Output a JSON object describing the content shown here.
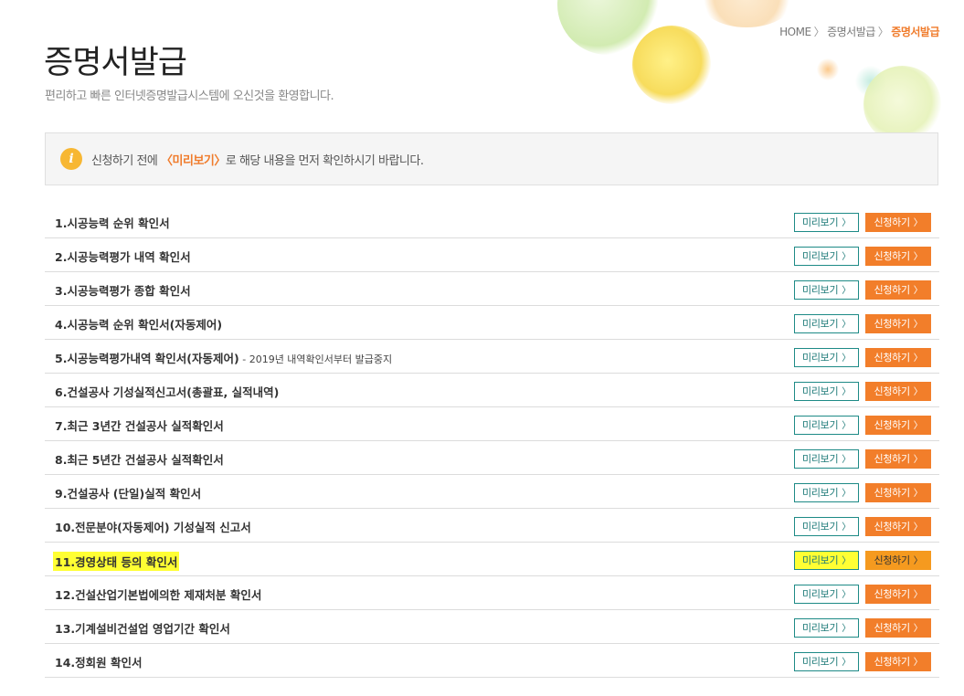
{
  "breadcrumb": {
    "home": "HOME",
    "parent": "증명서발급",
    "current": "증명서발급",
    "sep": "〉"
  },
  "page": {
    "title": "증명서발급",
    "subtitle": "편리하고 빠른 인터넷증명발급시스템에 오신것을 환영합니다."
  },
  "notice": {
    "icon": "i",
    "before": "신청하기 전에 ",
    "highlight": "〈미리보기〉",
    "after": "로 해당 내용을 먼저 확인하시기 바랍니다."
  },
  "buttons": {
    "preview_label": "미리보기",
    "apply_label": "신청하기",
    "arrow": "〉"
  },
  "colors": {
    "accent_orange": "#f27e2a",
    "preview_border": "#1d8a86",
    "highlight_yellow": "#ffff33"
  },
  "certificates": [
    {
      "title": "1.시공능력 순위 확인서",
      "note": ""
    },
    {
      "title": "2.시공능력평가 내역 확인서",
      "note": ""
    },
    {
      "title": "3.시공능력평가 종합 확인서",
      "note": ""
    },
    {
      "title": "4.시공능력 순위 확인서(자동제어)",
      "note": ""
    },
    {
      "title": "5.시공능력평가내역 확인서(자동제어)",
      "note": " - 2019년 내역확인서부터 발급중지"
    },
    {
      "title": "6.건설공사 기성실적신고서(총괄표, 실적내역)",
      "note": ""
    },
    {
      "title": "7.최근 3년간 건설공사 실적확인서",
      "note": ""
    },
    {
      "title": "8.최근 5년간 건설공사 실적확인서",
      "note": ""
    },
    {
      "title": "9.건설공사 (단일)실적 확인서",
      "note": ""
    },
    {
      "title": "10.전문분야(자동제어) 기성실적 신고서",
      "note": ""
    },
    {
      "title": "11.경영상태 등의 확인서",
      "note": "",
      "highlighted": true
    },
    {
      "title": "12.건설산업기본법에의한 제재처분 확인서",
      "note": ""
    },
    {
      "title": "13.기계설비건설업 영업기간 확인서",
      "note": ""
    },
    {
      "title": "14.정회원 확인서",
      "note": ""
    }
  ]
}
